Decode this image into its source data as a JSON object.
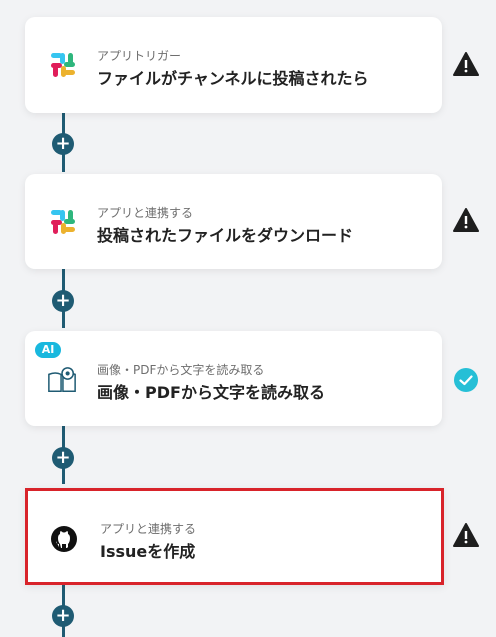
{
  "steps": [
    {
      "subtitle": "アプリトリガー",
      "title": "ファイルがチャンネルに投稿されたら",
      "icon": "slack-icon",
      "status": "warning"
    },
    {
      "subtitle": "アプリと連携する",
      "title": "投稿されたファイルをダウンロード",
      "icon": "slack-icon",
      "status": "warning"
    },
    {
      "subtitle": "画像・PDFから文字を読み取る",
      "title": "画像・PDFから文字を読み取る",
      "icon": "book-eye-icon",
      "status": "ok",
      "badge": "AI"
    },
    {
      "subtitle": "アプリと連携する",
      "title": "Issueを作成",
      "icon": "github-icon",
      "status": "warning"
    }
  ],
  "add_label": "+",
  "colors": {
    "connector": "#1f5b73",
    "highlight": "#d8232a",
    "ok": "#26bfd6",
    "warning": "#1e1e1e"
  }
}
